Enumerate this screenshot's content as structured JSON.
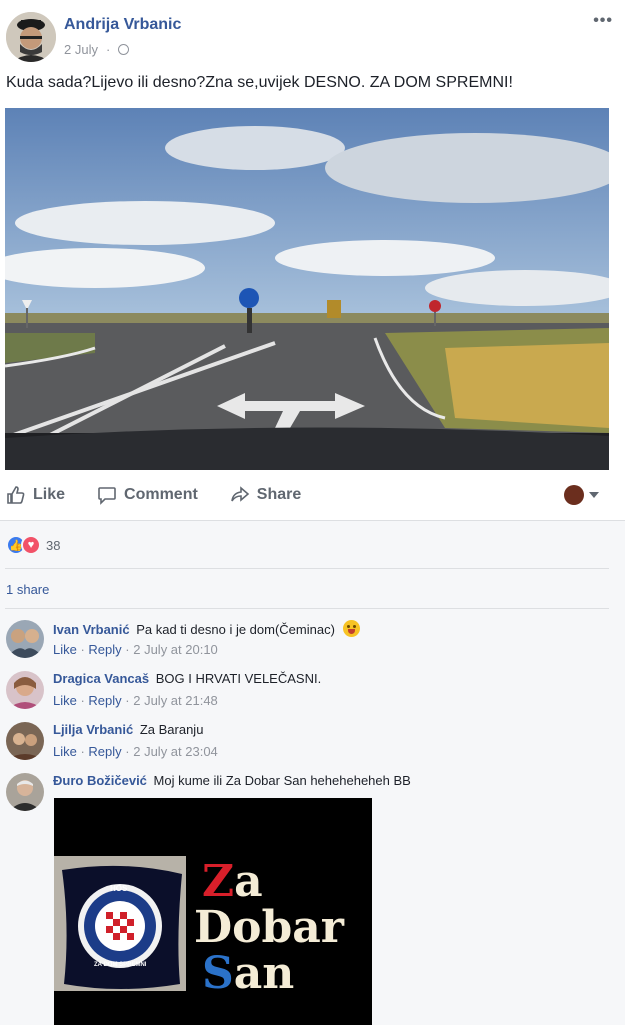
{
  "post": {
    "author": "Andrija Vrbanic",
    "date": "2 July",
    "text": "Kuda sada?Lijevo ili desno?Zna se,uvijek DESNO. ZA DOM SPREMNI!",
    "more_label": "•••",
    "photo_icon": "road-photo"
  },
  "actions": {
    "like": "Like",
    "comment": "Comment",
    "share": "Share"
  },
  "feedback": {
    "reaction_count": "38",
    "shares": "1 share"
  },
  "comments": [
    {
      "name": "Ivan Vrbanić",
      "text": "Pa kad ti desno i je dom(Čeminac)",
      "like": "Like",
      "reply": "Reply",
      "time": "2 July at 20:10"
    },
    {
      "name": "Dragica Vancaš",
      "text": "BOG I HRVATI VELEČASNI.",
      "like": "Like",
      "reply": "Reply",
      "time": "2 July at 21:48"
    },
    {
      "name": "Ljilja Vrbanić",
      "text": "Za Baranju",
      "like": "Like",
      "reply": "Reply",
      "time": "2 July at 23:04"
    },
    {
      "name": "Đuro Božičević",
      "text": "Moj kume ili Za Dobar San heheheheheh BB"
    }
  ],
  "sticker": {
    "line1_red": "Z",
    "line1_rest": "a",
    "line2": "Dobar",
    "line3_blue": "S",
    "line3_rest": "an",
    "pillow_top": "HOS",
    "pillow_bottom": "ZA DOM SPREMNI"
  },
  "colors": {
    "link": "#365899",
    "muted": "#90949c",
    "feedback_bg": "#f6f7f9"
  }
}
